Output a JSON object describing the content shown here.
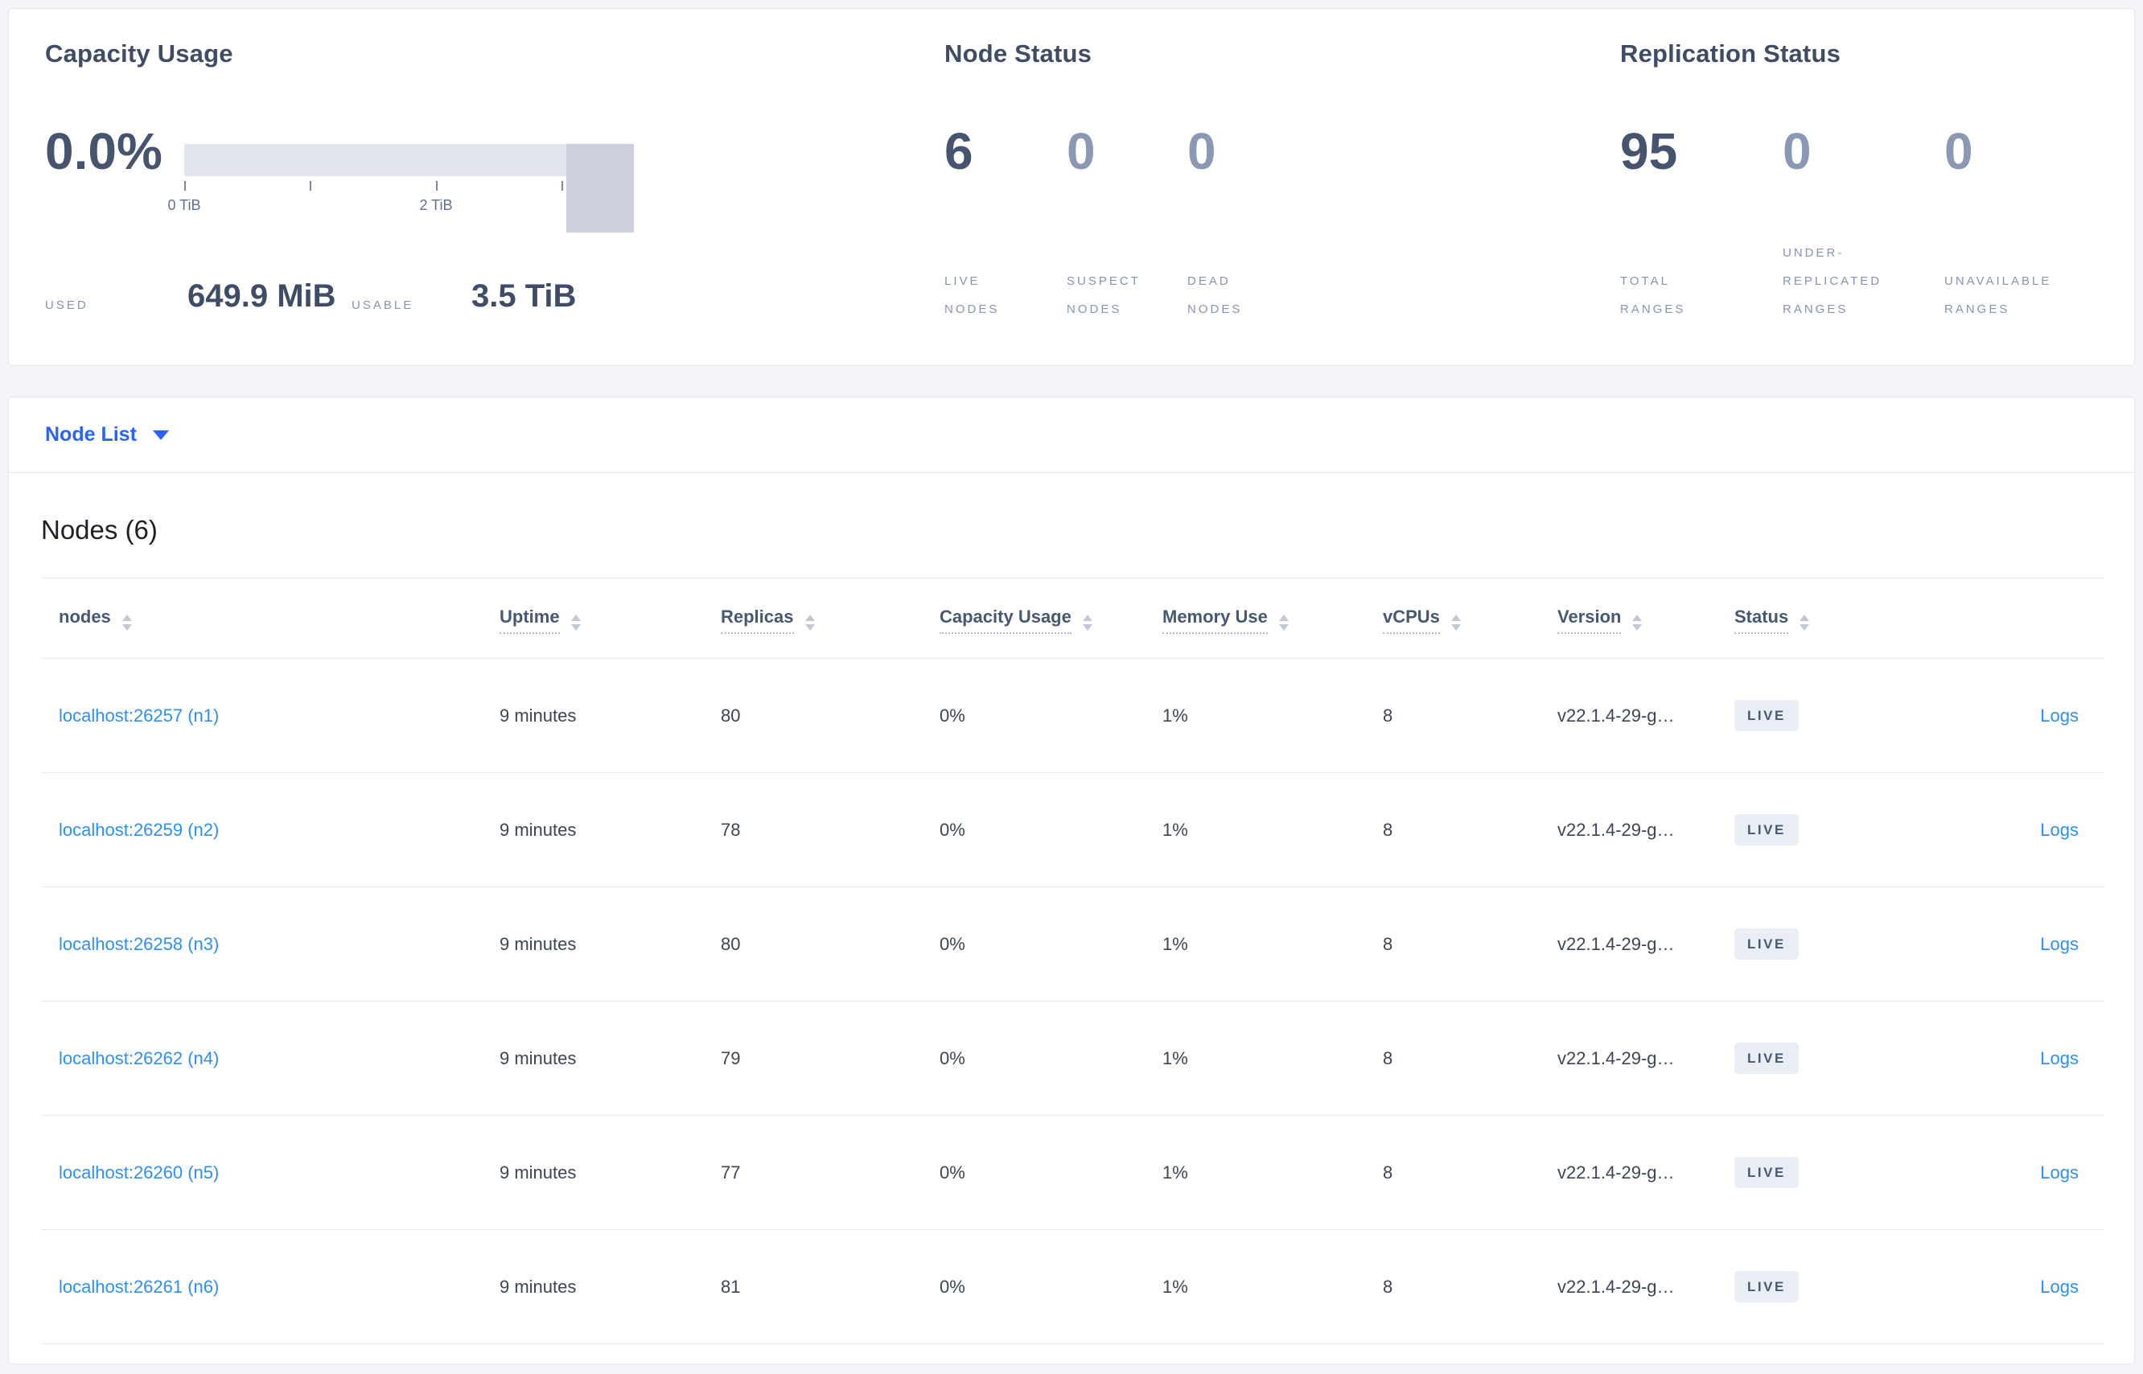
{
  "colors": {
    "page_background": "#f4f5f9",
    "card_background": "#ffffff",
    "accent_blue": "#2962ff",
    "link_blue": "#2e90f2",
    "heading_slate": "#3f4c63",
    "stat_dark": "#46546e",
    "stat_muted": "#8a98b3",
    "bar_light": "#e3e5ee",
    "bar_dark": "#ccd0dc",
    "badge_background": "#e9edf4",
    "badge_text": "#475872"
  },
  "summary_cards": {
    "capacity": {
      "title": "Capacity Usage",
      "percent": "0.0%",
      "tick_label_0": "0 TiB",
      "tick_label_2": "2 TiB",
      "used_label": "USED",
      "used_value": "649.9 MiB",
      "usable_label": "USABLE",
      "usable_value": "3.5 TiB"
    },
    "node_status": {
      "title": "Node Status",
      "stats": [
        {
          "value": "6",
          "label": "LIVE NODES"
        },
        {
          "value": "0",
          "label": "SUSPECT NODES"
        },
        {
          "value": "0",
          "label": "DEAD NODES"
        }
      ]
    },
    "replication_status": {
      "title": "Replication Status",
      "stats": [
        {
          "value": "95",
          "label": "TOTAL RANGES"
        },
        {
          "value": "0",
          "label": "UNDER-REPLICATED RANGES"
        },
        {
          "value": "0",
          "label": "UNAVAILABLE RANGES"
        }
      ]
    }
  },
  "view_selector": {
    "label": "Node List"
  },
  "nodes_section": {
    "title": "Nodes (6)",
    "columns": [
      {
        "label": "nodes"
      },
      {
        "label": "Uptime"
      },
      {
        "label": "Replicas"
      },
      {
        "label": "Capacity Usage"
      },
      {
        "label": "Memory Use"
      },
      {
        "label": "vCPUs"
      },
      {
        "label": "Version"
      },
      {
        "label": "Status"
      }
    ],
    "rows": [
      {
        "address": "localhost:26257 (n1)",
        "uptime": "9 minutes",
        "replicas": "80",
        "capacity_usage": "0%",
        "memory_use": "1%",
        "vcpus": "8",
        "version": "v22.1.4-29-g…",
        "status": "LIVE",
        "logs": "Logs"
      },
      {
        "address": "localhost:26259 (n2)",
        "uptime": "9 minutes",
        "replicas": "78",
        "capacity_usage": "0%",
        "memory_use": "1%",
        "vcpus": "8",
        "version": "v22.1.4-29-g…",
        "status": "LIVE",
        "logs": "Logs"
      },
      {
        "address": "localhost:26258 (n3)",
        "uptime": "9 minutes",
        "replicas": "80",
        "capacity_usage": "0%",
        "memory_use": "1%",
        "vcpus": "8",
        "version": "v22.1.4-29-g…",
        "status": "LIVE",
        "logs": "Logs"
      },
      {
        "address": "localhost:26262 (n4)",
        "uptime": "9 minutes",
        "replicas": "79",
        "capacity_usage": "0%",
        "memory_use": "1%",
        "vcpus": "8",
        "version": "v22.1.4-29-g…",
        "status": "LIVE",
        "logs": "Logs"
      },
      {
        "address": "localhost:26260 (n5)",
        "uptime": "9 minutes",
        "replicas": "77",
        "capacity_usage": "0%",
        "memory_use": "1%",
        "vcpus": "8",
        "version": "v22.1.4-29-g…",
        "status": "LIVE",
        "logs": "Logs"
      },
      {
        "address": "localhost:26261 (n6)",
        "uptime": "9 minutes",
        "replicas": "81",
        "capacity_usage": "0%",
        "memory_use": "1%",
        "vcpus": "8",
        "version": "v22.1.4-29-g…",
        "status": "LIVE",
        "logs": "Logs"
      }
    ]
  }
}
